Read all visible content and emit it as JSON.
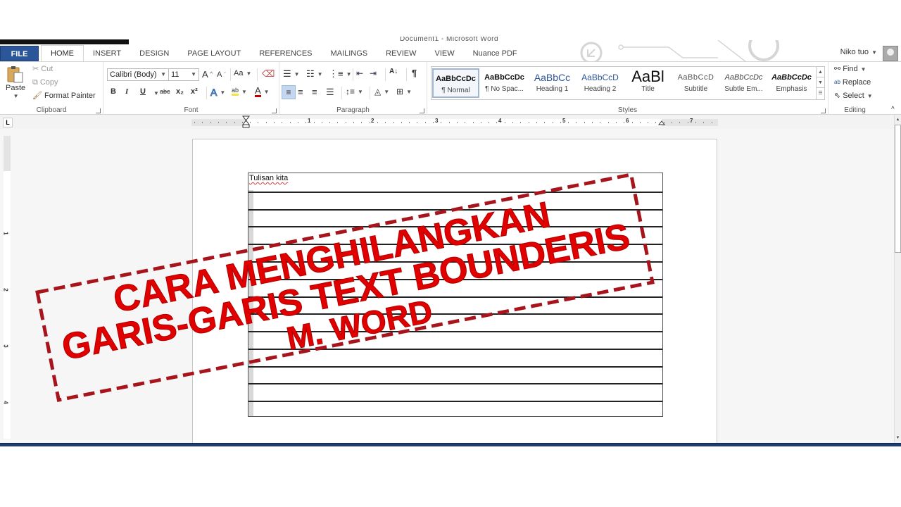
{
  "window": {
    "title": "Document1 - Microsoft Word",
    "user_name": "Niko tuo"
  },
  "tabs": [
    {
      "label": "FILE"
    },
    {
      "label": "HOME"
    },
    {
      "label": "INSERT"
    },
    {
      "label": "DESIGN"
    },
    {
      "label": "PAGE LAYOUT"
    },
    {
      "label": "REFERENCES"
    },
    {
      "label": "MAILINGS"
    },
    {
      "label": "REVIEW"
    },
    {
      "label": "VIEW"
    },
    {
      "label": "Nuance PDF"
    }
  ],
  "active_tab": "HOME",
  "ribbon": {
    "clipboard": {
      "label": "Clipboard",
      "paste": "Paste",
      "cut": "Cut",
      "copy": "Copy",
      "format_painter": "Format Painter"
    },
    "font": {
      "label": "Font",
      "font_name": "Calibri (Body)",
      "font_size": "11",
      "grow": "A",
      "shrink": "A",
      "change_case": "Aa",
      "bold": "B",
      "italic": "I",
      "underline": "U",
      "strikethrough": "abc",
      "subscript": "x₂",
      "superscript": "x²",
      "text_effects": "A",
      "highlight": "ab",
      "font_color": "A"
    },
    "paragraph": {
      "label": "Paragraph",
      "show_marks": "¶",
      "sort": "A↓"
    },
    "styles": {
      "label": "Styles",
      "items": [
        {
          "preview": "AaBbCcDc",
          "name": "¶ Normal",
          "selected": true
        },
        {
          "preview": "AaBbCcDc",
          "name": "¶ No Spac..."
        },
        {
          "preview": "AaBbCc",
          "name": "Heading 1"
        },
        {
          "preview": "AaBbCcD",
          "name": "Heading 2"
        },
        {
          "preview": "AaBl",
          "name": "Title"
        },
        {
          "preview": "AaBbCcD",
          "name": "Subtitle"
        },
        {
          "preview": "AaBbCcDc",
          "name": "Subtle Em..."
        },
        {
          "preview": "AaBbCcDc",
          "name": "Emphasis"
        }
      ]
    },
    "editing": {
      "label": "Editing",
      "find": "Find",
      "replace": "Replace",
      "select": "Select"
    }
  },
  "ruler": {
    "numbers": [
      "1",
      "2",
      "3",
      "4",
      "5",
      "6",
      "7"
    ],
    "vertical_numbers": [
      "1",
      "2",
      "3",
      "4"
    ]
  },
  "document": {
    "textbox_text": "Tulisan kita",
    "line_count": 13
  },
  "overlay": {
    "line1": "CARA MENGHILANGKAN",
    "line2": "GARIS-GARIS TEXT BOUNDERIS",
    "line3": "M. WORD",
    "color": "#e00000",
    "border_color": "#a8141c"
  }
}
